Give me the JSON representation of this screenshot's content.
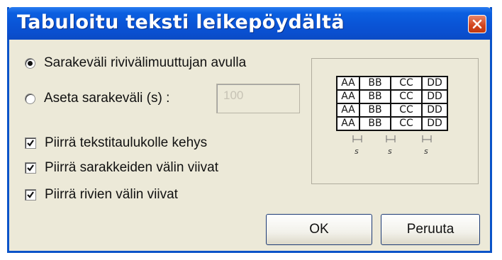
{
  "window": {
    "title": "Tabuloitu teksti leikepöydältä"
  },
  "options": {
    "radio1": {
      "label": "Sarakeväli rivivälimuuttujan avulla",
      "checked": true
    },
    "radio2": {
      "label": "Aseta sarakeväli (s) :",
      "checked": false
    },
    "spacing_value": "100"
  },
  "checkboxes": [
    {
      "label": "Piirrä tekstitaulukolle kehys",
      "checked": true
    },
    {
      "label": "Piirrä sarakkeiden välin viivat",
      "checked": true
    },
    {
      "label": "Piirrä rivien välin viivat",
      "checked": true
    }
  ],
  "preview": {
    "rows": [
      [
        "AA",
        "BB",
        "CC",
        "DD"
      ],
      [
        "AA",
        "BB",
        "CC",
        "DD"
      ],
      [
        "AA",
        "BB",
        "CC",
        "DD"
      ],
      [
        "AA",
        "BB",
        "CC",
        "DD"
      ]
    ],
    "separator_label": "s"
  },
  "buttons": {
    "ok": "OK",
    "cancel": "Peruuta"
  },
  "colors": {
    "titlebar": "#0a54d6",
    "dialog_bg": "#ece9d8",
    "close": "#d2431c"
  },
  "icons": {
    "close": "close-icon",
    "check": "checkmark-icon"
  }
}
